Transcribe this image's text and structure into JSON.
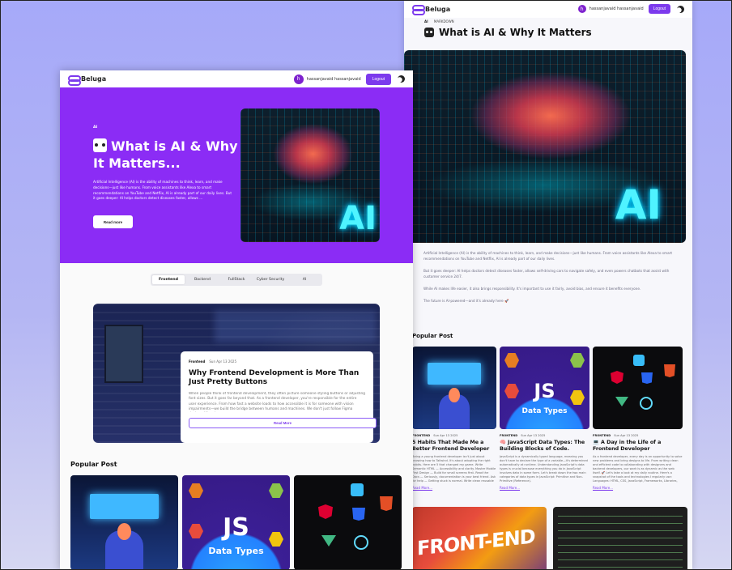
{
  "brand": {
    "name": "Beluga"
  },
  "user": {
    "initial": "h",
    "name": "hassanjavaid hassanjavaid"
  },
  "nav": {
    "logout_label": "Logout"
  },
  "detail": {
    "category": "AI",
    "crumb": "MARKDOWN",
    "title": "What is AI & Why It Matters",
    "hero_glyph": "AI",
    "paragraphs": [
      "Artificial Intelligence (AI) is the ability of machines to think, learn, and make decisions—just like humans. From voice assistants like Alexa to smart recommendations on YouTube and Netflix, AI is already part of our daily lives.",
      "But it goes deeper: AI helps doctors detect diseases faster, allows self-driving cars to navigate safely, and even powers chatbots that assist with customer service 24/7.",
      "While AI makes life easier, it also brings responsibility. It's important to use it fairly, avoid bias, and ensure it benefits everyone.",
      "The future is AI-powered—and it's already here 🚀"
    ],
    "popular_heading": "Popular Post",
    "popular": [
      {
        "category": "FRONTEND",
        "date": "Sun Apr 13 2025",
        "title": "5 Habits That Made Me a Better Frontend Developer",
        "excerpt": "Being a young frontend developer isn't just about knowing how to Tailwind. It's about adopting the right habits. Here are 5 that changed my game. Write Semantic HTML — Accessibility and clarity. Master Mobile First Design — Build for small screens first. Read the Docs — Seriously, documentation is your best friend. Ask for help — Getting stuck is normal. Write clean reusable components.",
        "read_more": "Read More..."
      },
      {
        "category": "FRONTEND",
        "date": "Sun Apr 13 2025",
        "title": "🧠 JavaScript Data Types: The Building Blocks of Code.",
        "excerpt": "JavaScript is a dynamically typed language, meaning you don't have to declare the type of a variable—it's determined automatically at runtime. Understanding JavaScript's data types is crucial because everything you do in JavaScript involves data in some form. Let's break down the two main categories of data types in JavaScript: Primitive and Non-Primitive (Reference).",
        "read_more": "Read More..."
      },
      {
        "category": "FRONTEND",
        "date": "Sun Apr 13 2025",
        "title": "💻 A Day in the Life of a Frontend Developer",
        "excerpt": "As a frontend developer, every day is an opportunity to solve new problems and bring designs to life. From writing clean and efficient code to collaborating with designers and backend developers, our work is as dynamic as the web itself. 🚀 Let's take a look at my daily routine. Here's a snapshot of the tools and technologies I regularly use: Languages: HTML, CSS, JavaScript, Frameworks, Libraries, Styling Tools, State Management.",
        "read_more": "Read More..."
      }
    ]
  },
  "home": {
    "hero": {
      "category": "AI",
      "title": "What is AI & Why It Matters...",
      "excerpt": "Artificial Intelligence (AI) is the ability of machines to think, learn, and make decisions—just like humans. From voice assistants like Alexa to smart recommendations on YouTube and Netflix, AI is already part of our daily lives. But it goes deeper: AI helps doctors detect diseases faster, allows ...",
      "read_more": "Read more",
      "glyph": "AI"
    },
    "tabs": [
      {
        "label": "Frontend",
        "active": true
      },
      {
        "label": "Backend",
        "active": false
      },
      {
        "label": "FullStack",
        "active": false
      },
      {
        "label": "Cyber Security",
        "active": false
      },
      {
        "label": "AI",
        "active": false
      }
    ],
    "featured": {
      "category": "Frontend",
      "date": "Sun Apr 13 2025",
      "title": "Why Frontend Development is More Than Just Pretty Buttons",
      "excerpt": "When people think of frontend development, they often picture someone styling buttons or adjusting font sizes. But it goes far beyond that. As a frontend developer, you're responsible for the entire user experience. From how fast a website loads to how accessible it is for someone with vision impairments—we build the bridge between humans and machines. We don't just follow Figma designs. We ask...",
      "read_more": "Read More"
    },
    "popular_heading": "Popular Post"
  },
  "thumbs": {
    "js_text": "JS",
    "data_types_text": "Data Types",
    "front_text": "FRONT-END"
  },
  "colors": {
    "accent": "#7c3aed",
    "hero_bg": "#8b2cf5"
  }
}
